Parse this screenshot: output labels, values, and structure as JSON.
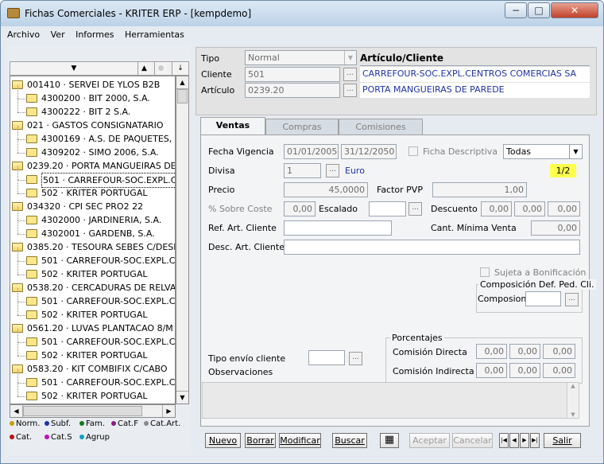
{
  "window": {
    "title": "Fichas Comerciales - KRITER ERP - [kempdemo]",
    "min_glyph": "−",
    "max_glyph": "□",
    "close_glyph": "✕"
  },
  "menu": [
    "Archivo",
    "Ver",
    "Informes",
    "Herramientas"
  ],
  "header_btns": {
    "down": "▼",
    "up": "▲",
    "circle": "●",
    "sort": "↓"
  },
  "tree": [
    {
      "level": 0,
      "label": "001410 · SERVEI DE YLOS B2B"
    },
    {
      "level": 1,
      "label": "4300200 · BIT 2000, S.A."
    },
    {
      "level": 1,
      "label": "4300222 · BIT 2 S.A."
    },
    {
      "level": 0,
      "label": "021 · GASTOS CONSIGNATARIO"
    },
    {
      "level": 1,
      "label": "4300169 · A.S. DE PAQUETES, S"
    },
    {
      "level": 1,
      "label": "4309202 · SIMO 2006, S.A."
    },
    {
      "level": 0,
      "label": "0239.20 · PORTA MANGUEIRAS DE"
    },
    {
      "level": 1,
      "label": "501 · CARREFOUR-SOC.EXPL.C",
      "selected": true
    },
    {
      "level": 1,
      "label": "502 · KRITER PORTUGAL"
    },
    {
      "level": 0,
      "label": "034320 · CPI SEC PRO2 22"
    },
    {
      "level": 1,
      "label": "4302000 · JARDINERIA, S.A."
    },
    {
      "level": 1,
      "label": "4302001 · GARDENB, S.A."
    },
    {
      "level": 0,
      "label": "0385.20 · TESOURA SEBES C/DESM"
    },
    {
      "level": 1,
      "label": "501 · CARREFOUR-SOC.EXPL.C"
    },
    {
      "level": 1,
      "label": "502 · KRITER PORTUGAL"
    },
    {
      "level": 0,
      "label": "0538.20 · CERCADURAS DE RELVA"
    },
    {
      "level": 1,
      "label": "501 · CARREFOUR-SOC.EXPL.C"
    },
    {
      "level": 1,
      "label": "502 · KRITER PORTUGAL"
    },
    {
      "level": 0,
      "label": "0561.20 · LUVAS PLANTACAO 8/M"
    },
    {
      "level": 1,
      "label": "501 · CARREFOUR-SOC.EXPL.C"
    },
    {
      "level": 1,
      "label": "502 · KRITER PORTUGAL"
    },
    {
      "level": 0,
      "label": "0583.20 · KIT COMBIFIX C/CABO"
    },
    {
      "level": 1,
      "label": "501 · CARREFOUR-SOC.EXPL.C"
    },
    {
      "level": 1,
      "label": "502 · KRITER PORTUGAL"
    }
  ],
  "legend": [
    {
      "label": "Norm.",
      "color": "#c8a000"
    },
    {
      "label": "Subf.",
      "color": "#1f2fa8"
    },
    {
      "label": "Fam.",
      "color": "#0f7a1a"
    },
    {
      "label": "Cat.F",
      "color": "#8a1a8a"
    },
    {
      "label": "Cat.Art.",
      "color": "#8a8a8a"
    },
    {
      "label": "Cat.",
      "color": "#c01010"
    },
    {
      "label": "Cat.S",
      "color": "#c010c0"
    },
    {
      "label": "Agrup",
      "color": "#10a0c0"
    }
  ],
  "form": {
    "tipo_label": "Tipo",
    "tipo_value": "Normal",
    "articulo_cliente": "Artículo/Cliente",
    "cliente_label": "Cliente",
    "cliente_code": "501",
    "cliente_name": "CARREFOUR-SOC.EXPL.CENTROS COMERCIAS SA",
    "articulo_label": "Artículo",
    "articulo_code": "0239.20",
    "articulo_name": "PORTA MANGUEIRAS DE PAREDE",
    "ellipsis": "..."
  },
  "tabs": [
    "Ventas",
    "Compras",
    "Comisiones"
  ],
  "ventas": {
    "fecha_vigencia_label": "Fecha Vigencia",
    "fecha_desde": "01/01/2005",
    "fecha_hasta": "31/12/2050",
    "ficha_descriptiva_label": "Ficha Descriptiva",
    "select_value": "Todas",
    "divisa_label": "Divisa",
    "divisa_code": "1",
    "divisa_name": "Euro",
    "page_indicator": "1/2",
    "precio_label": "Precio",
    "precio_value": "45,0000",
    "factor_pvp_label": "Factor PVP",
    "factor_pvp_value": "1,00",
    "sobre_coste_label": "% Sobre Coste",
    "sobre_coste_value": "0,00",
    "escalado_label": "Escalado",
    "descuento_label": "Descuento",
    "descuento_values": [
      "0,00",
      "0,00",
      "0,00"
    ],
    "ref_art_cliente_label": "Ref. Art. Cliente",
    "cant_minima_label": "Cant. Mínima Venta",
    "cant_minima_value": "0,00",
    "desc_art_cliente_label": "Desc. Art. Cliente",
    "sujeta_bonificacion_label": "Sujeta a Bonificación",
    "composicion_title": "Composición Def. Ped. Cli.",
    "composicion_label": "Composion",
    "tipo_envio_label": "Tipo envío cliente",
    "observaciones_label": "Observaciones",
    "porcentajes_title": "Porcentajes",
    "comision_directa_label": "Comisión Directa",
    "comision_directa_values": [
      "0,00",
      "0,00",
      "0,00"
    ],
    "comision_indirecta_label": "Comisión Indirecta",
    "comision_indirecta_values": [
      "0,00",
      "0,00",
      "0,00"
    ]
  },
  "buttons": {
    "nuevo": "Nuevo",
    "borrar": "Borrar",
    "modificar": "Modificar",
    "buscar": "Buscar",
    "aceptar": "Aceptar",
    "cancelar": "Cancelar",
    "salir": "Salir"
  },
  "nav": [
    "|◀",
    "◀",
    "▶",
    "▶|"
  ]
}
